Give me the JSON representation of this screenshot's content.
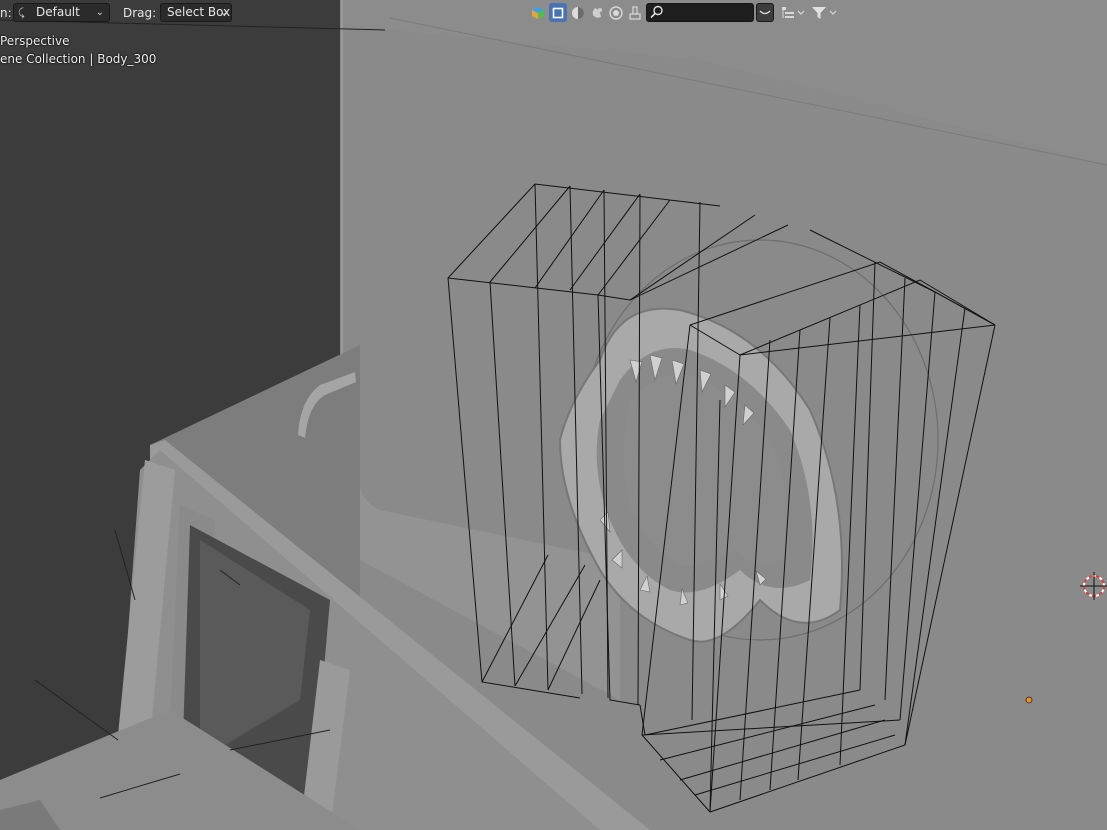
{
  "header": {
    "orientation_label": "n:",
    "orientation_value": "Default",
    "drag_label": "Drag:",
    "drag_value": "Select Box",
    "search_placeholder": "",
    "icons": [
      "overlay-colors-icon",
      "select-box-icon",
      "viewport-shading-icon",
      "material-preview-icon",
      "rendered-icon",
      "brush-icon",
      "search-icon",
      "toggle-down-icon",
      "outliner-display-icon",
      "filter-icon"
    ],
    "accent_color": "#4772b3"
  },
  "viewport": {
    "view_name": "Perspective",
    "collection_path": "ene Collection | Body_300"
  }
}
